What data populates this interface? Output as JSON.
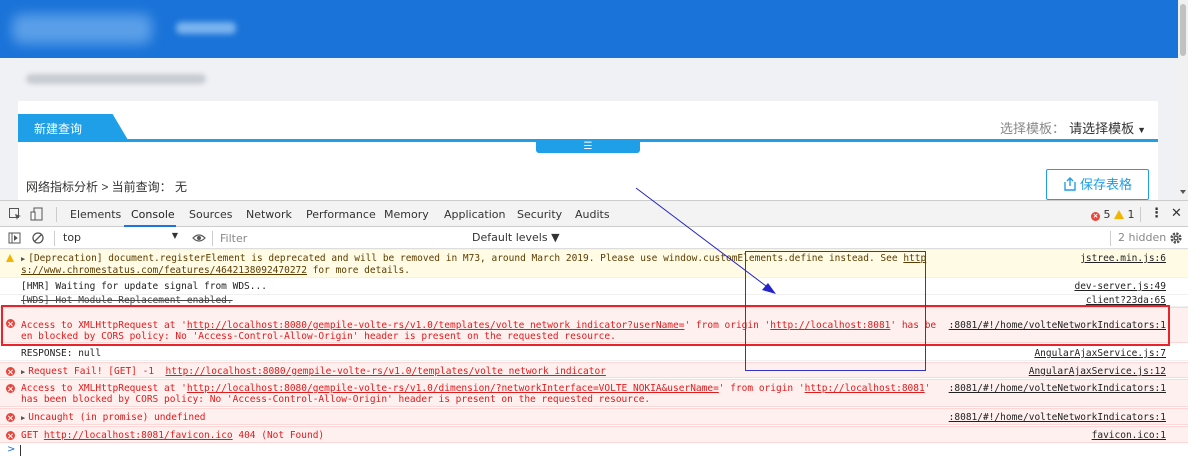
{
  "app": {
    "tab_new_query": "新建查询",
    "template_label": "选择模板：",
    "template_value": "请选择模板",
    "breadcrumb": "网络指标分析 > 当前查询： 无",
    "save_button": "保存表格",
    "colors": {
      "header": "#1a73d8",
      "accent": "#1e9fe8"
    }
  },
  "devtools": {
    "tabs": [
      "Elements",
      "Console",
      "Sources",
      "Network",
      "Performance",
      "Memory",
      "Application",
      "Security",
      "Audits"
    ],
    "active_tab": "Console",
    "error_count": "5",
    "warning_count": "1",
    "context": "top",
    "filter_placeholder": "Filter",
    "levels": "Default levels ▼",
    "hidden": "2 hidden",
    "messages": [
      {
        "level": "warning",
        "text_a": "[Deprecation] document.registerElement is deprecated and will be removed in M73, around March 2019. Please use window.customElements.define instead. See ",
        "link": "https://www.chromestatus.com/features/4642138092470272",
        "text_b": " for more details.",
        "source": "jstree.min.js:6"
      },
      {
        "level": "info",
        "text": "[HMR] Waiting for update signal from WDS...",
        "source": "dev-server.js:49"
      },
      {
        "level": "info",
        "text": "[WDS] Hot Module Replacement enabled.",
        "source": "client?23da:65"
      },
      {
        "level": "error",
        "text_a": "Access to XMLHttpRequest at '",
        "link": "http://localhost:8080/gempile-volte-rs/v1.0/templates/volte network indicator?userName=",
        "text_b": "' from origin '",
        "link2": "http://localhost:8081",
        "text_c": "' has been blocked by CORS policy: No 'Access-Control-Allow-Origin' header is present on the requested resource.",
        "source": ":8081/#!/home/volteNetworkIndicators:1"
      },
      {
        "level": "info",
        "text": "RESPONSE: null",
        "source": "AngularAjaxService.js:7"
      },
      {
        "level": "error",
        "text_a": "Request Fail! [GET] -1  ",
        "link": "http://localhost:8080/gempile-volte-rs/v1.0/templates/volte network indicator",
        "source": "AngularAjaxService.js:12"
      },
      {
        "level": "error",
        "text_a": "Access to XMLHttpRequest at '",
        "link": "http://localhost:8080/gempile-volte-rs/v1.0/dimension/?networkInterface=VOLTE NOKIA&userName=",
        "text_b": "' from origin '",
        "link2": "http://localhost:8081",
        "text_c": "' has been blocked by CORS policy: No 'Access-Control-Allow-Origin' header is present on the requested resource.",
        "source": ":8081/#!/home/volteNetworkIndicators:1"
      },
      {
        "level": "error",
        "text": "Uncaught (in promise) undefined",
        "source": ":8081/#!/home/volteNetworkIndicators:1"
      },
      {
        "level": "error",
        "text_a": "GET ",
        "link": "http://localhost:8081/favicon.ico",
        "text_b": " 404 (Not Found)",
        "source": "favicon.ico:1"
      }
    ],
    "prompt": ">"
  }
}
